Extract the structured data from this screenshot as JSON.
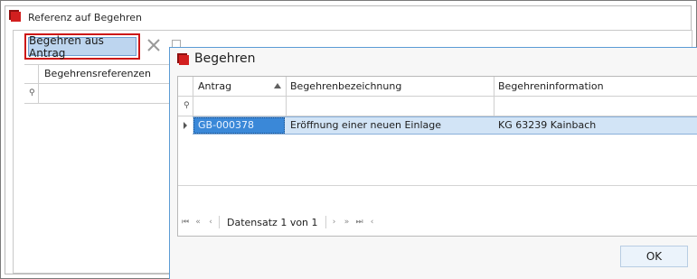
{
  "outer_window": {
    "title": "Referenz auf Begehren"
  },
  "toolbar": {
    "begehren_aus_antrag_label": "Begehren aus Antrag"
  },
  "left_grid": {
    "column_header": "Begehrensreferenzen"
  },
  "dialog": {
    "title": "Begehren",
    "columns": [
      "Antrag",
      "Begehrenbezeichnung",
      "Begehreninformation"
    ],
    "rows": [
      {
        "antrag": "GB-000378",
        "bezeichnung": "Eröffnung einer neuen Einlage",
        "information": "KG 63239 Kainbach"
      }
    ],
    "navigator": {
      "record_text": "Datensatz 1 von 1"
    },
    "ok_label": "OK"
  },
  "colors": {
    "accent_red": "#cc1717",
    "selection_blue": "#3a88d8",
    "row_highlight": "#d2e4f6"
  }
}
